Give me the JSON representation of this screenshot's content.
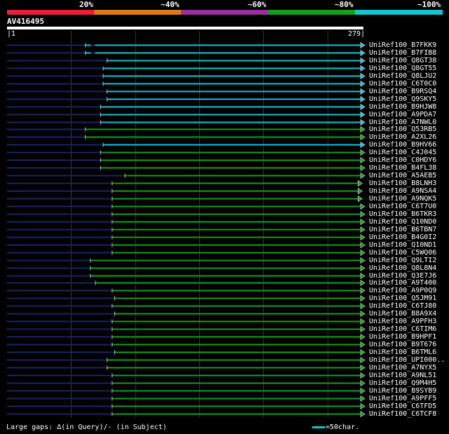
{
  "legend": {
    "labels": [
      "20%",
      "~40%",
      "~60%",
      "~80%",
      "~100%"
    ],
    "colors": [
      "#e8213a",
      "#e0761c",
      "#992f9b",
      "#12a01a",
      "#16c3d2"
    ]
  },
  "query": {
    "name": "AV416495",
    "start": "1",
    "end": "279"
  },
  "hits": [
    {
      "name": "UniRef100_B7FKK9",
      "start": 62,
      "color": "cyan",
      "gap": true
    },
    {
      "name": "UniRef100_B7FIB8",
      "start": 62,
      "color": "cyan",
      "gap": true
    },
    {
      "name": "UniRef100_Q8GT38",
      "start": 79,
      "color": "cyan"
    },
    {
      "name": "UniRef100_Q8GT55",
      "start": 76,
      "color": "cyan"
    },
    {
      "name": "UniRef100_Q8LJU2",
      "start": 76,
      "color": "cyan"
    },
    {
      "name": "UniRef100_C6T0C0",
      "start": 76,
      "color": "cyan"
    },
    {
      "name": "UniRef100_B9RSQ4",
      "start": 79,
      "color": "cyan"
    },
    {
      "name": "UniRef100_Q9SKY5",
      "start": 79,
      "color": "cyan"
    },
    {
      "name": "UniRef100_B9HJW8",
      "start": 74,
      "color": "cyan"
    },
    {
      "name": "UniRef100_A9PDA7",
      "start": 74,
      "color": "cyan"
    },
    {
      "name": "UniRef100_A7NWL0",
      "start": 74,
      "color": "cyan"
    },
    {
      "name": "UniRef100_Q53RB5",
      "start": 62,
      "color": "green"
    },
    {
      "name": "UniRef100_A2XL26",
      "start": 62,
      "color": "green"
    },
    {
      "name": "UniRef100_B9HV66",
      "start": 76,
      "color": "cyan"
    },
    {
      "name": "UniRef100_C4J045",
      "start": 74,
      "color": "green"
    },
    {
      "name": "UniRef100_C0HDY6",
      "start": 74,
      "color": "green"
    },
    {
      "name": "UniRef100_B4FL38",
      "start": 74,
      "color": "green"
    },
    {
      "name": "UniRef100_A5AEB5",
      "start": 93,
      "color": "green"
    },
    {
      "name": "UniRef100_B8LNH3",
      "start": 83,
      "color": "green",
      "end": 277
    },
    {
      "name": "UniRef100_A9NSA4",
      "start": 83,
      "color": "green",
      "end": 277
    },
    {
      "name": "UniRef100_A9NQK5",
      "start": 83,
      "color": "green",
      "end": 277
    },
    {
      "name": "UniRef100_C6T7U0",
      "start": 83,
      "color": "green"
    },
    {
      "name": "UniRef100_B6TKR3",
      "start": 83,
      "color": "green"
    },
    {
      "name": "UniRef100_Q10ND0",
      "start": 83,
      "color": "green"
    },
    {
      "name": "UniRef100_B6TBN7",
      "start": 83,
      "color": "green"
    },
    {
      "name": "UniRef100_B4G0I2",
      "start": 83,
      "color": "green"
    },
    {
      "name": "UniRef100_Q10ND1",
      "start": 83,
      "color": "green"
    },
    {
      "name": "UniRef100_C5WQ06",
      "start": 83,
      "color": "green"
    },
    {
      "name": "UniRef100_Q9LTI2",
      "start": 66,
      "color": "green"
    },
    {
      "name": "UniRef100_Q8L8N4",
      "start": 66,
      "color": "green"
    },
    {
      "name": "UniRef100_Q3E7J6",
      "start": 66,
      "color": "green"
    },
    {
      "name": "UniRef100_A9T400",
      "start": 70,
      "color": "green"
    },
    {
      "name": "UniRef100_A9P0Q9",
      "start": 83,
      "color": "green"
    },
    {
      "name": "UniRef100_Q5JM91",
      "start": 85,
      "color": "green"
    },
    {
      "name": "UniRef100_C6TJ80",
      "start": 83,
      "color": "green"
    },
    {
      "name": "UniRef100_B8A9X4",
      "start": 85,
      "color": "green"
    },
    {
      "name": "UniRef100_A9PFH3",
      "start": 83,
      "color": "green"
    },
    {
      "name": "UniRef100_C6TIM6",
      "start": 83,
      "color": "green"
    },
    {
      "name": "UniRef100_B9HPF1",
      "start": 83,
      "color": "green"
    },
    {
      "name": "UniRef100_B9T676",
      "start": 83,
      "color": "green"
    },
    {
      "name": "UniRef100_B6TML6",
      "start": 85,
      "color": "green"
    },
    {
      "name": "UniRef100_UPI000..",
      "start": 79,
      "color": "green"
    },
    {
      "name": "UniRef100_A7NYX5",
      "start": 79,
      "color": "green"
    },
    {
      "name": "UniRef100_A9NL51",
      "start": 83,
      "color": "green"
    },
    {
      "name": "UniRef100_Q9M4H5",
      "start": 83,
      "color": "green"
    },
    {
      "name": "UniRef100_B9SYB9",
      "start": 83,
      "color": "green"
    },
    {
      "name": "UniRef100_A9PFF5",
      "start": 83,
      "color": "green"
    },
    {
      "name": "UniRef100_C6TFD5",
      "start": 83,
      "color": "green"
    },
    {
      "name": "UniRef100_C6TCF8",
      "start": 83,
      "color": "green"
    }
  ],
  "footer": {
    "gaps_text": "Large gaps: ∆(in Query)/- (in Subject)",
    "scale_text": "=50char."
  }
}
